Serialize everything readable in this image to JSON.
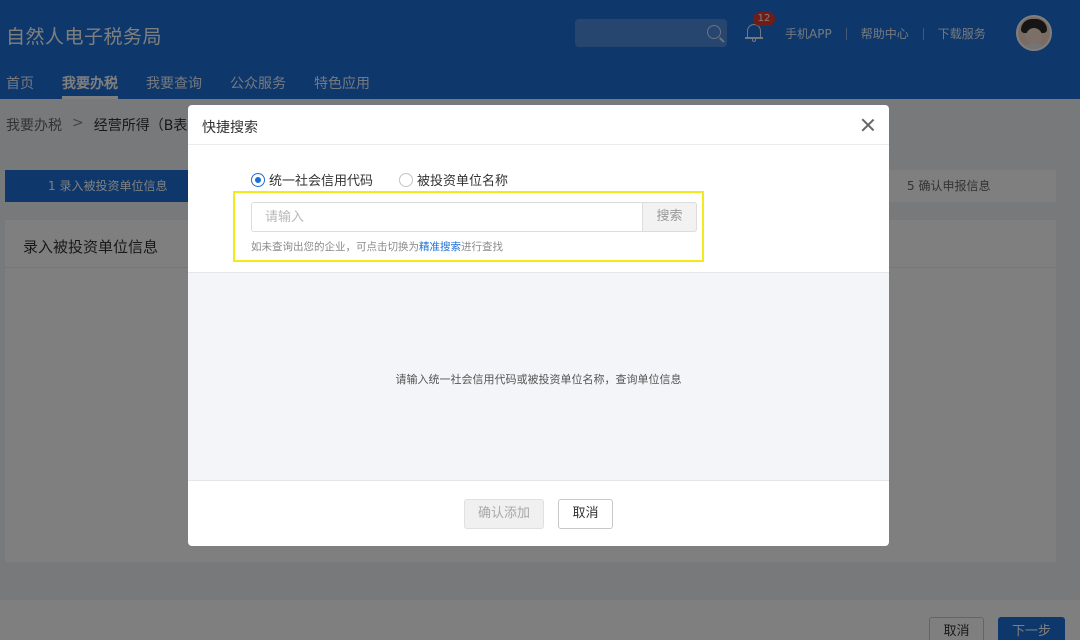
{
  "app": {
    "title": "自然人电子税务局"
  },
  "header": {
    "notification_count": "12",
    "links": [
      "手机APP",
      "帮助中心",
      "下载服务"
    ]
  },
  "nav": {
    "items": [
      "首页",
      "我要办税",
      "我要查询",
      "公众服务",
      "特色应用"
    ],
    "active_index": 1
  },
  "breadcrumb": {
    "root": "我要办税",
    "separator": ">",
    "current": "经营所得（B表"
  },
  "steps": {
    "step1": "1  录入被投资单位信息",
    "step5": "5  确认申报信息"
  },
  "panel": {
    "title": "录入被投资单位信息"
  },
  "footer": {
    "cancel_label": "取消",
    "next_label": "下一步"
  },
  "dialog": {
    "title": "快捷搜索",
    "radio_options": [
      {
        "label": "统一社会信用代码",
        "checked": true
      },
      {
        "label": "被投资单位名称",
        "checked": false
      }
    ],
    "search": {
      "placeholder": "请输入",
      "value": "",
      "button_label": "搜索"
    },
    "hint": {
      "prefix": "如未查询出您的企业，可点击切换为",
      "link": "精准搜索",
      "suffix": "进行查找"
    },
    "empty_message": "请输入统一社会信用代码或被投资单位名称，查询单位信息",
    "confirm_label": "确认添加",
    "cancel_label": "取消"
  },
  "colors": {
    "brand": "#1d6fd6",
    "highlight": "#f2ea1b",
    "badge": "#e03a2f"
  }
}
